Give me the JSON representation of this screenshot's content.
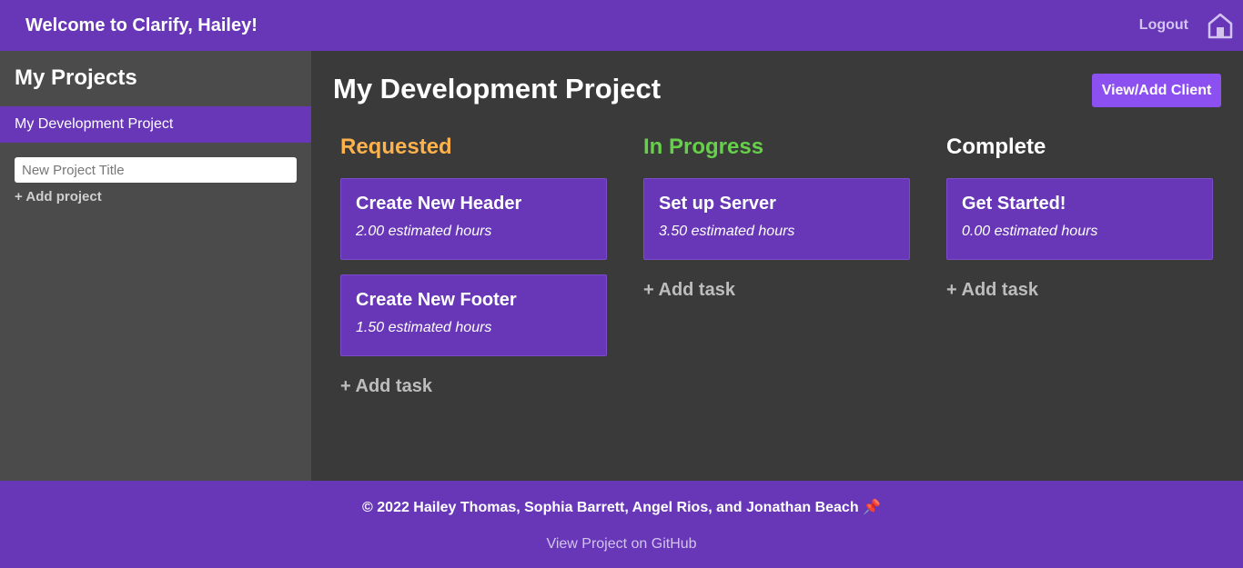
{
  "header": {
    "welcome": "Welcome to Clarify, Hailey!",
    "logout": "Logout",
    "home_icon": "home-icon"
  },
  "sidebar": {
    "heading": "My Projects",
    "projects": [
      {
        "label": "My Development Project",
        "active": true
      }
    ],
    "new_project_placeholder": "New Project Title",
    "new_project_value": "",
    "add_project": "+ Add project"
  },
  "main": {
    "project_title": "My Development Project",
    "client_button": "View/Add Client",
    "columns": [
      {
        "title": "Requested",
        "color": "#ffb24c",
        "tasks": [
          {
            "title": "Create New Header",
            "hours": "2.00 estimated hours"
          },
          {
            "title": "Create New Footer",
            "hours": "1.50 estimated hours"
          }
        ],
        "add_task": "+ Add task"
      },
      {
        "title": "In Progress",
        "color": "#66d04a",
        "tasks": [
          {
            "title": "Set up Server",
            "hours": "3.50 estimated hours"
          }
        ],
        "add_task": "+ Add task"
      },
      {
        "title": "Complete",
        "color": "#ffffff",
        "tasks": [
          {
            "title": "Get Started!",
            "hours": "0.00 estimated hours"
          }
        ],
        "add_task": "+ Add task"
      }
    ]
  },
  "footer": {
    "copyright": "© 2022 Hailey Thomas, Sophia Barrett, Angel Rios, and Jonathan Beach 📌",
    "github": "View Project on GitHub"
  },
  "colors": {
    "brand": "#6737b8",
    "accent_button": "#8c4ff0",
    "sidebar_bg": "#4b4b4b",
    "main_bg": "#3a3a3a"
  }
}
